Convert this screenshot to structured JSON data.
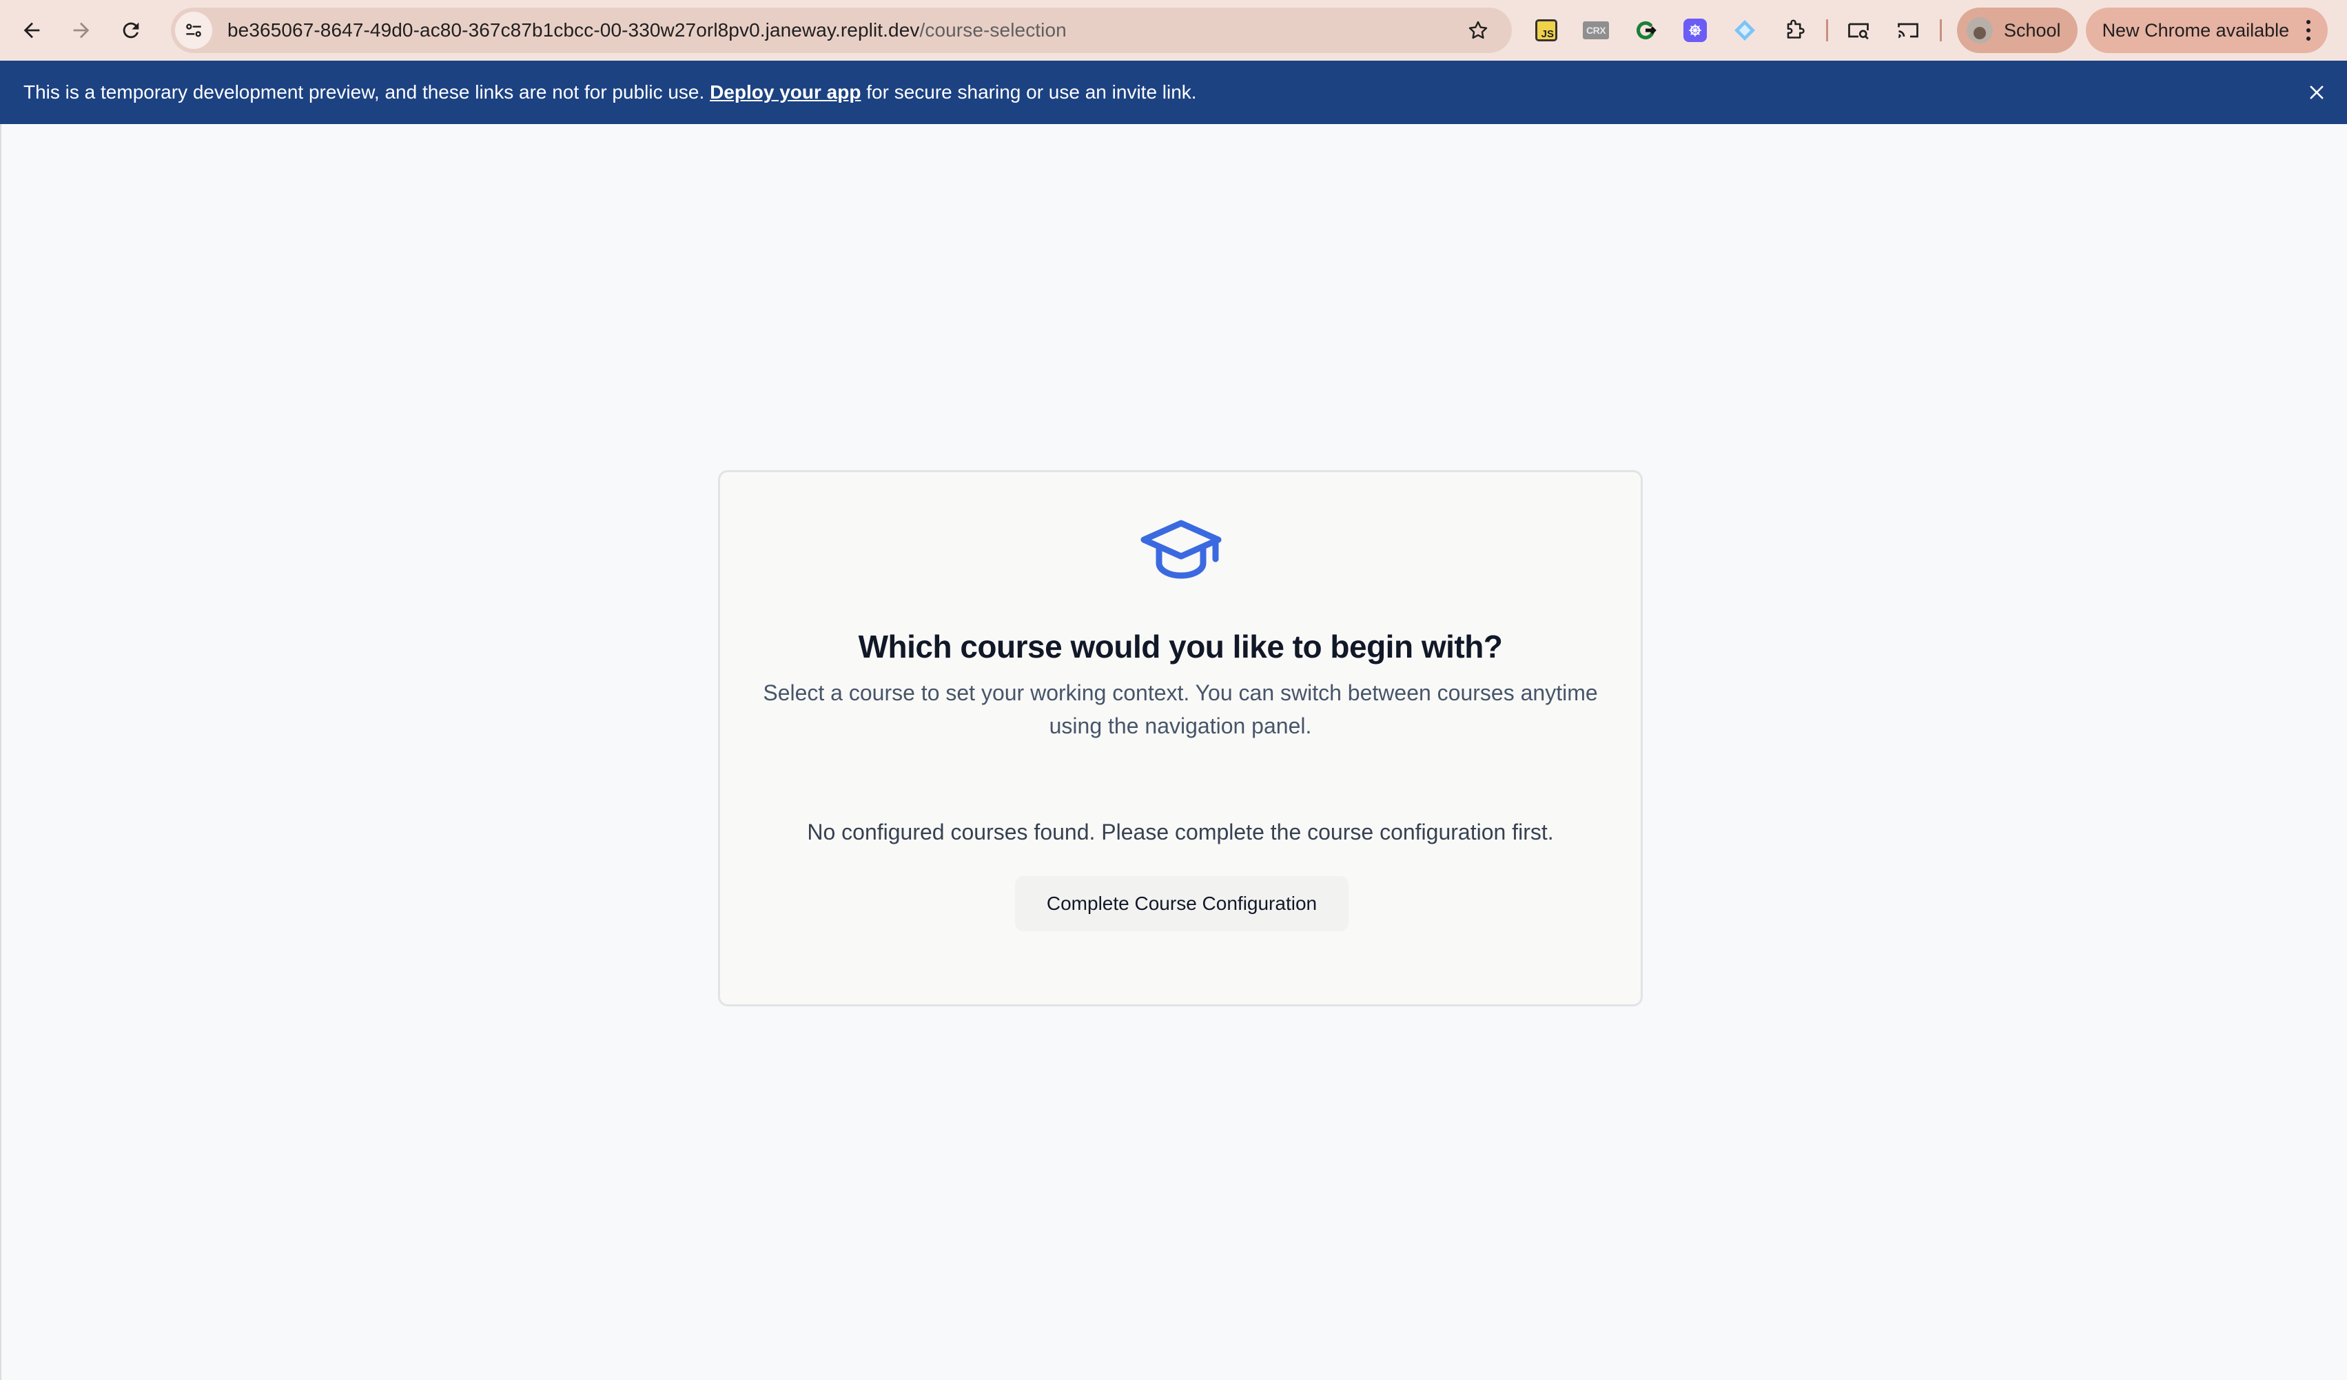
{
  "browser": {
    "url_host": "be365067-8647-49d0-ac80-367c87b1cbcc-00-330w27orl8pv0.janeway.replit.dev",
    "url_path": "/course-selection",
    "extensions": [
      "js-extension-icon",
      "crx-extension-icon",
      "grammar-extension-icon",
      "purple-extension-icon",
      "diamond-extension-icon",
      "puzzle-extensions-icon"
    ],
    "profile_label": "School",
    "update_label": "New Chrome available",
    "theme_color": "#f4e3dc"
  },
  "banner": {
    "text_before": "This is a temporary development preview, and these links are not for public use. ",
    "link_text": "Deploy your app",
    "text_after": " for secure sharing or use an invite link.",
    "background": "#1c4282"
  },
  "card": {
    "icon": "graduation-cap-icon",
    "icon_color": "#3b6ae0",
    "title": "Which course would you like to begin with?",
    "subtitle": "Select a course to set your working context. You can switch between courses anytime using the navigation panel.",
    "empty_message": "No configured courses found. Please complete the course configuration first.",
    "cta_label": "Complete Course Configuration"
  }
}
